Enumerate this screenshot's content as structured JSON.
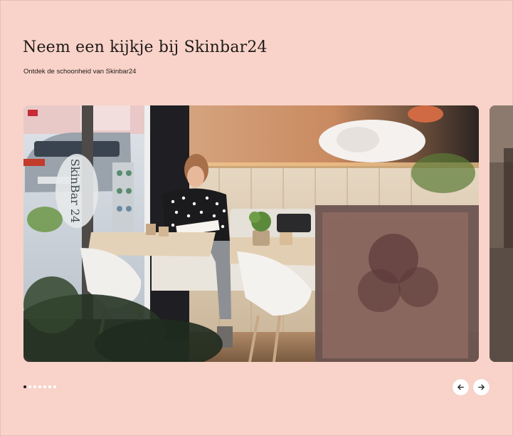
{
  "section": {
    "title": "Neem een kijkje bij Skinbar24",
    "subtitle": "Ontdek de schoonheid van Skinbar24"
  },
  "gallery": {
    "window_lettering": "SkinBar 24",
    "slide_count": 7,
    "active_index": 0
  },
  "controls": {
    "prev_icon": "arrow-left-icon",
    "next_icon": "arrow-right-icon"
  },
  "colors": {
    "background": "#f9d3c9",
    "text": "#1e1a18",
    "button": "#ffffff"
  }
}
